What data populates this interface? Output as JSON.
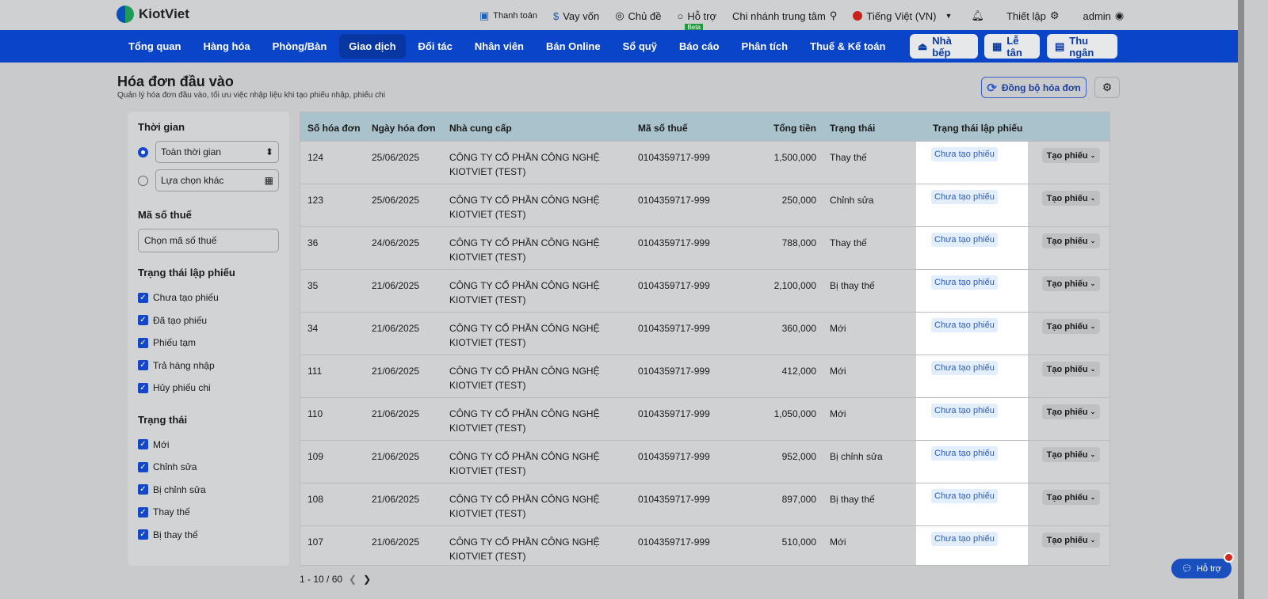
{
  "brand": "KiotViet",
  "topbar": {
    "payment": "Thanh toán",
    "loan": "Vay vốn",
    "theme": "Chủ đề",
    "support": "Hỗ trợ",
    "beta": "Beta",
    "branch": "Chi nhánh trung tâm",
    "language": "Tiếng Việt (VN)",
    "settings": "Thiết lập",
    "user": "admin"
  },
  "nav": {
    "items": [
      "Tổng quan",
      "Hàng hóa",
      "Phòng/Bàn",
      "Giao dịch",
      "Đối tác",
      "Nhân viên",
      "Bán Online",
      "Sổ quỹ",
      "Báo cáo",
      "Phân tích",
      "Thuế & Kế toán"
    ],
    "active": "Giao dịch",
    "kitchen": "Nhà bếp",
    "reception": "Lễ tân",
    "cashier": "Thu ngân"
  },
  "page": {
    "title": "Hóa đơn đầu vào",
    "subtitle": "Quản lý hóa đơn đầu vào, tối ưu việc nhập liệu khi tạo phiếu nhập, phiếu chi",
    "sync": "Đồng bộ hóa đơn"
  },
  "filters": {
    "time_title": "Thời gian",
    "time_all": "Toàn thời gian",
    "time_other": "Lựa chọn khác",
    "tax_title": "Mã số thuế",
    "tax_placeholder": "Chọn mã số thuế",
    "voucher_title": "Trạng thái lập phiếu",
    "voucher_options": [
      "Chưa tạo phiếu",
      "Đã tạo phiếu",
      "Phiếu tạm",
      "Trả hàng nhập",
      "Hủy phiếu chi"
    ],
    "status_title": "Trạng thái",
    "status_options": [
      "Mới",
      "Chỉnh sửa",
      "Bị chỉnh sửa",
      "Thay thế",
      "Bị thay thế"
    ]
  },
  "table": {
    "headers": [
      "Số hóa đơn",
      "Ngày hóa đơn",
      "Nhà cung cấp",
      "Mã số thuế",
      "Tổng tiền",
      "Trạng thái",
      "Trạng thái lập phiếu"
    ],
    "action_label": "Tạo phiếu",
    "rows": [
      {
        "no": "124",
        "date": "25/06/2025",
        "supplier1": "CÔNG TY CỔ PHẦN CÔNG NGHỆ",
        "supplier2": "KIOTVIET (TEST)",
        "tax": "0104359717-999",
        "total": "1,500,000",
        "status": "Thay thế",
        "voucher": "Chưa tạo phiếu"
      },
      {
        "no": "123",
        "date": "25/06/2025",
        "supplier1": "CÔNG TY CỔ PHẦN CÔNG NGHỆ",
        "supplier2": "KIOTVIET (TEST)",
        "tax": "0104359717-999",
        "total": "250,000",
        "status": "Chỉnh sửa",
        "voucher": "Chưa tạo phiếu"
      },
      {
        "no": "36",
        "date": "24/06/2025",
        "supplier1": "CÔNG TY CỔ PHẦN CÔNG NGHỆ",
        "supplier2": "KIOTVIET (TEST)",
        "tax": "0104359717-999",
        "total": "788,000",
        "status": "Thay thế",
        "voucher": "Chưa tạo phiếu"
      },
      {
        "no": "35",
        "date": "21/06/2025",
        "supplier1": "CÔNG TY CỔ PHẦN CÔNG NGHỆ",
        "supplier2": "KIOTVIET (TEST)",
        "tax": "0104359717-999",
        "total": "2,100,000",
        "status": "Bị thay thế",
        "voucher": "Chưa tạo phiếu"
      },
      {
        "no": "34",
        "date": "21/06/2025",
        "supplier1": "CÔNG TY CỔ PHẦN CÔNG NGHỆ",
        "supplier2": "KIOTVIET (TEST)",
        "tax": "0104359717-999",
        "total": "360,000",
        "status": "Mới",
        "voucher": "Chưa tạo phiếu"
      },
      {
        "no": "111",
        "date": "21/06/2025",
        "supplier1": "CÔNG TY CỔ PHẦN CÔNG NGHỆ",
        "supplier2": "KIOTVIET (TEST)",
        "tax": "0104359717-999",
        "total": "412,000",
        "status": "Mới",
        "voucher": "Chưa tạo phiếu"
      },
      {
        "no": "110",
        "date": "21/06/2025",
        "supplier1": "CÔNG TY CỔ PHẦN CÔNG NGHỆ",
        "supplier2": "KIOTVIET (TEST)",
        "tax": "0104359717-999",
        "total": "1,050,000",
        "status": "Mới",
        "voucher": "Chưa tạo phiếu"
      },
      {
        "no": "109",
        "date": "21/06/2025",
        "supplier1": "CÔNG TY CỔ PHẦN CÔNG NGHỆ",
        "supplier2": "KIOTVIET (TEST)",
        "tax": "0104359717-999",
        "total": "952,000",
        "status": "Bị chỉnh sửa",
        "voucher": "Chưa tạo phiếu"
      },
      {
        "no": "108",
        "date": "21/06/2025",
        "supplier1": "CÔNG TY CỔ PHẦN CÔNG NGHỆ",
        "supplier2": "KIOTVIET (TEST)",
        "tax": "0104359717-999",
        "total": "897,000",
        "status": "Bị thay thế",
        "voucher": "Chưa tạo phiếu"
      },
      {
        "no": "107",
        "date": "21/06/2025",
        "supplier1": "CÔNG TY CỔ PHẦN CÔNG NGHỆ",
        "supplier2": "KIOTVIET (TEST)",
        "tax": "0104359717-999",
        "total": "510,000",
        "status": "Mới",
        "voucher": "Chưa tạo phiếu"
      }
    ]
  },
  "pager": {
    "range": "1 - 10 / 60"
  },
  "help": "Hỗ trợ"
}
